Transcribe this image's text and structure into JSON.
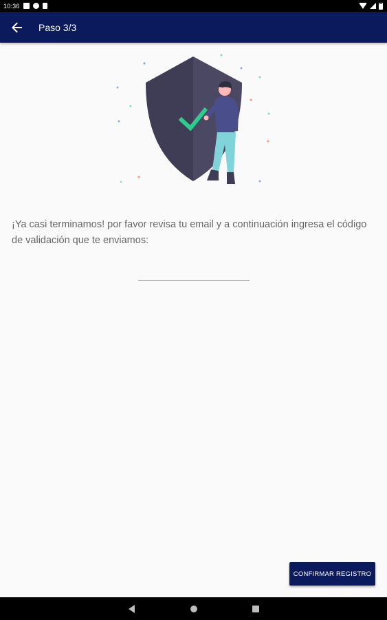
{
  "status_bar": {
    "time": "10:36",
    "icons": [
      "notification-icon",
      "app-icon",
      "storage-icon",
      "wifi-icon",
      "cell-signal-icon",
      "battery-icon"
    ]
  },
  "app_bar": {
    "title": "Paso 3/3",
    "back_icon": "arrow-back-icon",
    "background": "#0b1a5c"
  },
  "illustration": {
    "name": "security-shield-illustration",
    "shield_color": "#3f3d56",
    "check_color": "#2ecc8f"
  },
  "main": {
    "message": "¡Ya casi terminamos! por favor revisa tu email y a continuación ingresa el código de validación que te enviamos:",
    "code_input": {
      "value": "",
      "placeholder": ""
    }
  },
  "actions": {
    "confirm_label": "CONFIRMAR REGISTRO",
    "accent": "#0b1a5c"
  },
  "nav_bar": {
    "icons": [
      "nav-back-icon",
      "nav-home-icon",
      "nav-recents-icon"
    ]
  }
}
